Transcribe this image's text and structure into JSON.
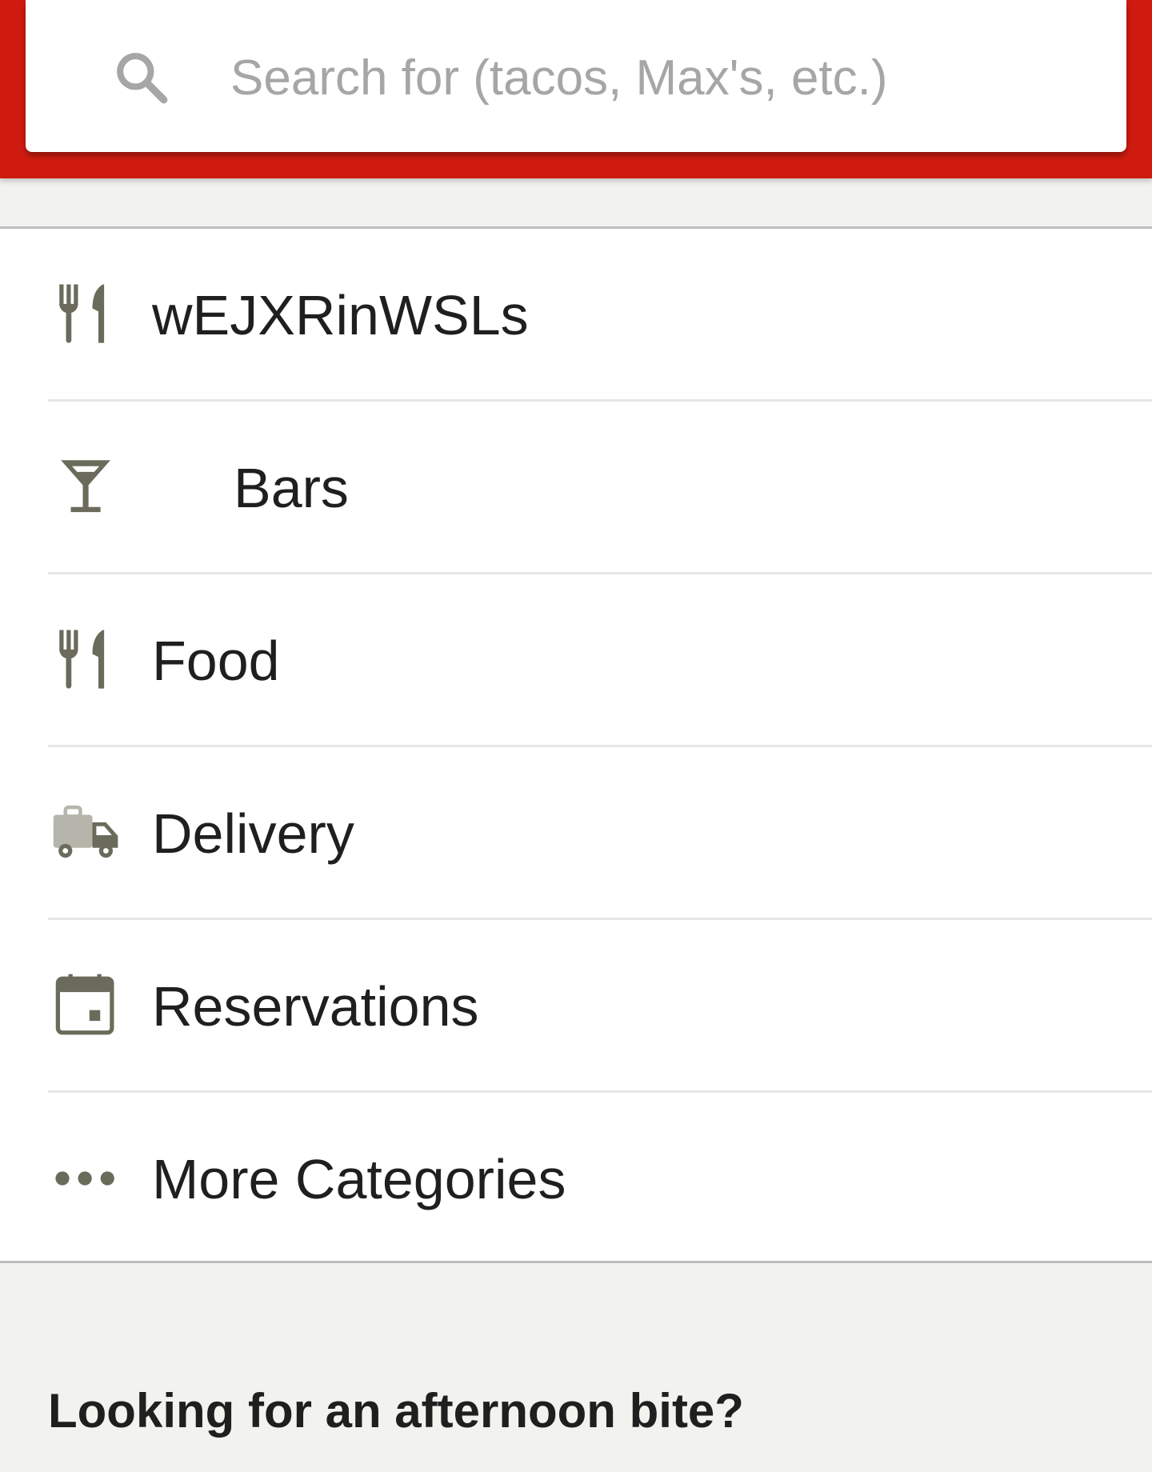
{
  "search": {
    "placeholder": "Search for (tacos, Max's, etc.)"
  },
  "categories": {
    "items": [
      {
        "label": "wEJXRinWSLs",
        "icon": "fork-knife-icon"
      },
      {
        "label": "Bars",
        "icon": "cocktail-glass-icon"
      },
      {
        "label": "Food",
        "icon": "fork-knife-icon"
      },
      {
        "label": "Delivery",
        "icon": "delivery-truck-icon"
      },
      {
        "label": "Reservations",
        "icon": "calendar-icon"
      },
      {
        "label": "More Categories",
        "icon": "more-dots-icon"
      }
    ]
  },
  "section": {
    "title": "Looking for an afternoon bite?"
  },
  "colors": {
    "header_red": "#cf1b0f",
    "icon_gray": "#6b6b5c",
    "text": "#1f1f1f",
    "placeholder": "#a6a6a6"
  }
}
